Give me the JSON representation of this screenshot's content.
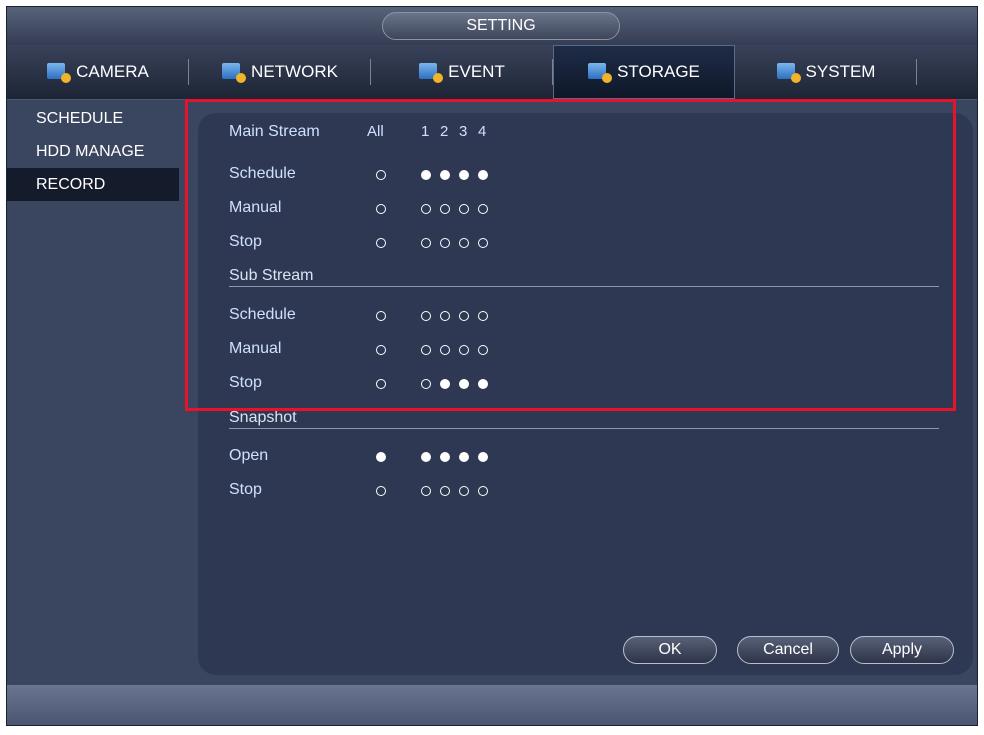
{
  "window": {
    "title": "SETTING"
  },
  "tabs": [
    {
      "label": "CAMERA",
      "icon": "camera-settings-icon"
    },
    {
      "label": "NETWORK",
      "icon": "network-settings-icon"
    },
    {
      "label": "EVENT",
      "icon": "event-settings-icon"
    },
    {
      "label": "STORAGE",
      "icon": "storage-settings-icon",
      "active": true
    },
    {
      "label": "SYSTEM",
      "icon": "system-settings-icon"
    }
  ],
  "sidebar": {
    "items": [
      {
        "label": "SCHEDULE"
      },
      {
        "label": "HDD MANAGE"
      },
      {
        "label": "RECORD",
        "active": true
      }
    ]
  },
  "record": {
    "main_stream": {
      "label": "Main Stream",
      "all_label": "All",
      "channels": [
        "1",
        "2",
        "3",
        "4"
      ],
      "rows": [
        {
          "label": "Schedule",
          "all": false,
          "channels": [
            true,
            true,
            true,
            true
          ]
        },
        {
          "label": "Manual",
          "all": false,
          "channels": [
            false,
            false,
            false,
            false
          ]
        },
        {
          "label": "Stop",
          "all": false,
          "channels": [
            false,
            false,
            false,
            false
          ]
        }
      ]
    },
    "sub_stream": {
      "label": "Sub Stream",
      "rows": [
        {
          "label": "Schedule",
          "all": false,
          "channels": [
            false,
            false,
            false,
            false
          ]
        },
        {
          "label": "Manual",
          "all": false,
          "channels": [
            false,
            false,
            false,
            false
          ]
        },
        {
          "label": "Stop",
          "all": false,
          "channels": [
            false,
            true,
            true,
            true
          ]
        }
      ]
    },
    "snapshot": {
      "label": "Snapshot",
      "rows": [
        {
          "label": "Open",
          "all": true,
          "channels": [
            true,
            true,
            true,
            true
          ]
        },
        {
          "label": "Stop",
          "all": false,
          "channels": [
            false,
            false,
            false,
            false
          ]
        }
      ]
    }
  },
  "buttons": {
    "ok": "OK",
    "cancel": "Cancel",
    "apply": "Apply"
  },
  "colors": {
    "highlight": "#e8132a",
    "panel_bg": "#2f3853",
    "frame_bg": "#3a4560",
    "label_text": "#cfe0ff"
  }
}
